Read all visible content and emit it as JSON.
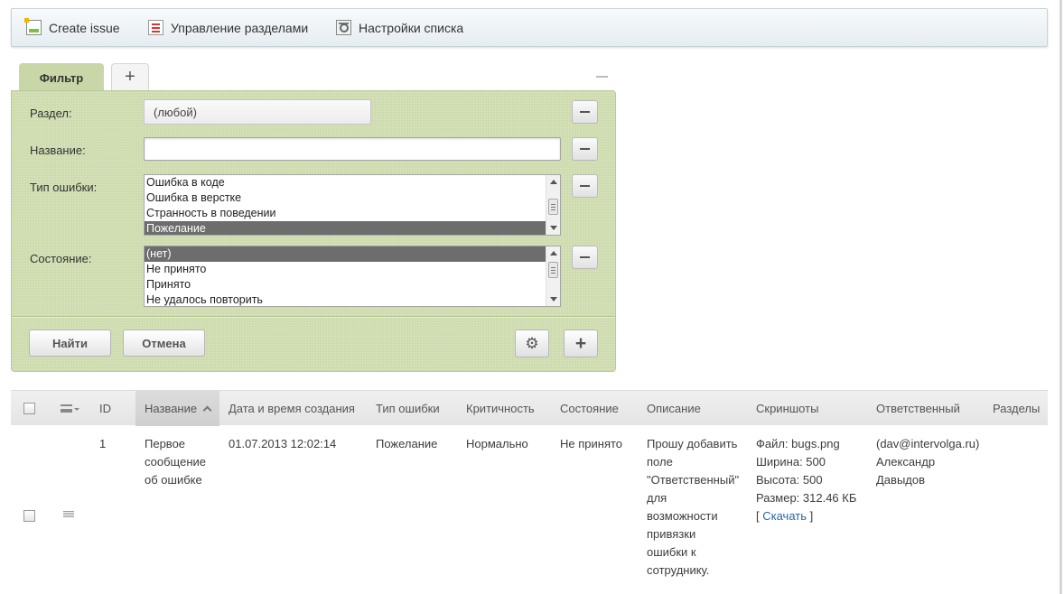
{
  "toolbar": {
    "create_label": "Create issue",
    "sections_label": "Управление разделами",
    "settings_label": "Настройки списка"
  },
  "filter": {
    "tab_label": "Фильтр",
    "add_tab_label": "+",
    "fields": {
      "section_label": "Раздел:",
      "section_value": "(любой)",
      "name_label": "Название:",
      "name_value": "",
      "bug_type_label": "Тип ошибки:",
      "bug_type_options": [
        "Ошибка в коде",
        "Ошибка в верстке",
        "Странность в поведении",
        "Пожелание"
      ],
      "bug_type_selected": "Пожелание",
      "state_label": "Состояние:",
      "state_options": [
        "(нет)",
        "Не принято",
        "Принято",
        "Не удалось повторить"
      ],
      "state_selected": "(нет)"
    },
    "find_label": "Найти",
    "cancel_label": "Отмена",
    "plus_label": "+"
  },
  "grid": {
    "columns": [
      "ID",
      "Название",
      "Дата и время создания",
      "Тип ошибки",
      "Критичность",
      "Состояние",
      "Описание",
      "Скриншоты",
      "Ответственный",
      "Разделы"
    ],
    "sorted_column": "Название",
    "rows": [
      {
        "id": "1",
        "name": [
          "Первое",
          "сообщение",
          "об ошибке"
        ],
        "created": "01.07.2013 12:02:14",
        "bug_type": "Пожелание",
        "criticality": "Нормально",
        "state": "Не принято",
        "description": [
          "Прошу добавить",
          "поле",
          "\"Ответственный\"",
          "для",
          "возможности",
          "привязки",
          "ошибки к",
          "сотруднику."
        ],
        "screenshot": {
          "file": "Файл: bugs.png",
          "width": "Ширина: 500",
          "height": "Высота: 500",
          "size": "Размер: 312.46 КБ",
          "download_open": "[ ",
          "download_link": "Скачать",
          "download_close": " ]"
        },
        "responsible": [
          "(dav@intervolga.ru)",
          "Александр",
          "Давыдов"
        ],
        "sections": ""
      }
    ]
  }
}
